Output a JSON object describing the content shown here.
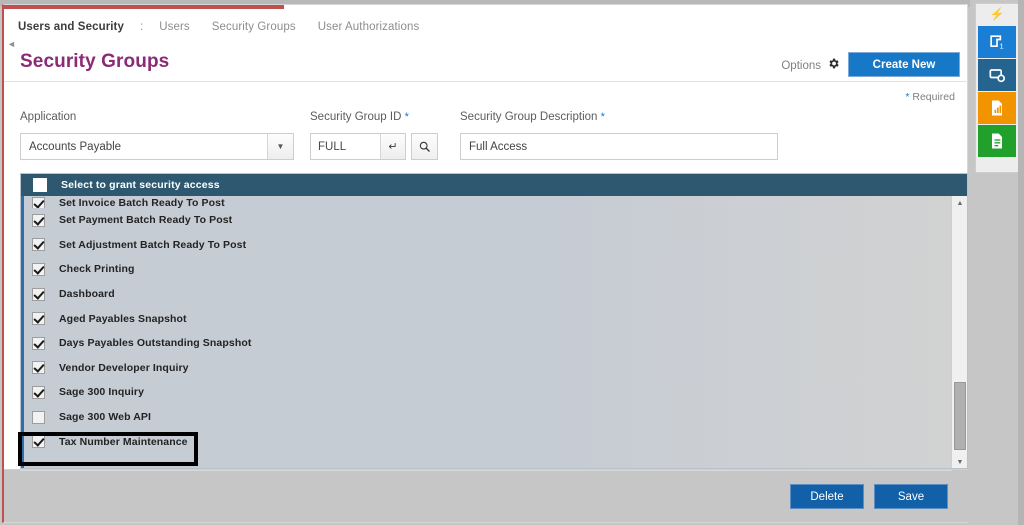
{
  "breadcrumb": {
    "current": "Users and Security",
    "separator": ":",
    "links": [
      "Users",
      "Security Groups",
      "User Authorizations"
    ]
  },
  "header": {
    "title": "Security Groups",
    "options_label": "Options",
    "gear_icon": "gear-icon",
    "create_new_label": "Create New",
    "required_note": "Required",
    "required_star": "*"
  },
  "form": {
    "application": {
      "label": "Application",
      "value": "Accounts Payable",
      "caret_icon": "chevron-down-icon"
    },
    "security_group_id": {
      "label": "Security Group ID",
      "required_star": "*",
      "value": "FULL",
      "enter_icon": "enter-key-icon",
      "search_icon": "search-icon"
    },
    "security_group_description": {
      "label": "Security Group Description",
      "required_star": "*",
      "value": "Full Access"
    }
  },
  "grid": {
    "header_label": "Select to grant security access",
    "header_checkbox_checked": false,
    "rows": [
      {
        "label": "Set Invoice Batch Ready To Post",
        "checked": true,
        "partial": true
      },
      {
        "label": "Set Payment Batch Ready To Post",
        "checked": true,
        "partial": false
      },
      {
        "label": "Set Adjustment Batch Ready To Post",
        "checked": true,
        "partial": false
      },
      {
        "label": "Check Printing",
        "checked": true,
        "partial": false
      },
      {
        "label": "Dashboard",
        "checked": true,
        "partial": false
      },
      {
        "label": "Aged Payables Snapshot",
        "checked": true,
        "partial": false
      },
      {
        "label": "Days Payables Outstanding Snapshot",
        "checked": true,
        "partial": false
      },
      {
        "label": "Vendor Developer Inquiry",
        "checked": true,
        "partial": false
      },
      {
        "label": "Sage 300 Inquiry",
        "checked": true,
        "partial": false
      },
      {
        "label": "Sage 300 Web API",
        "checked": false,
        "partial": false
      },
      {
        "label": "Tax Number Maintenance",
        "checked": true,
        "partial": false
      }
    ],
    "scrollbar": {
      "up_arrow_icon": "chevron-up-icon",
      "down_arrow_icon": "chevron-down-icon"
    }
  },
  "footer": {
    "delete_label": "Delete",
    "save_label": "Save"
  },
  "right_rail": {
    "bolt_icon": "lightning-bolt-icon",
    "buttons": [
      {
        "icon": "screen-1-icon",
        "color": "#1a7fd4"
      },
      {
        "icon": "screen-settings-icon",
        "color": "#24648f"
      },
      {
        "icon": "report-chart-icon",
        "color": "#f29400"
      },
      {
        "icon": "document-icon",
        "color": "#22a02c"
      }
    ]
  },
  "colors": {
    "title_purple": "#8b2b75",
    "primary_blue": "#1878c8",
    "grid_header": "#2d5870",
    "footer_button": "#1261a8",
    "accent_red": "#c0504d"
  }
}
